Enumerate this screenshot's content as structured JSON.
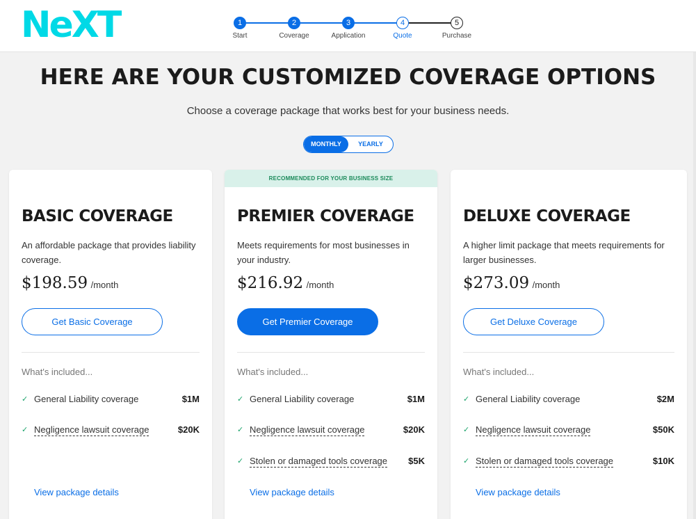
{
  "brand": {
    "logo": "NeXT",
    "logo_color": "#00d9e6",
    "accent": "#0a6ee6"
  },
  "steps": [
    {
      "num": "1",
      "label": "Start",
      "status": "done"
    },
    {
      "num": "2",
      "label": "Coverage",
      "status": "done"
    },
    {
      "num": "3",
      "label": "Application",
      "status": "done"
    },
    {
      "num": "4",
      "label": "Quote",
      "status": "current"
    },
    {
      "num": "5",
      "label": "Purchase",
      "status": "todo"
    }
  ],
  "page": {
    "title": "Here are your customized coverage options",
    "subtitle": "Choose a coverage package that works best for your business needs."
  },
  "toggle": {
    "monthly": "MONTHLY",
    "yearly": "YEARLY",
    "selected": "monthly"
  },
  "cards": [
    {
      "title": "BASIC COVERAGE",
      "description": "An affordable package that provides liability coverage.",
      "price": "$198.59",
      "per": "/month",
      "cta": "Get Basic Coverage",
      "included_label": "What's included...",
      "features": [
        {
          "label": "General Liability coverage",
          "value": "$1M"
        },
        {
          "label": "Negligence lawsuit coverage",
          "value": "$20K"
        }
      ],
      "details_link": "View package details"
    },
    {
      "banner": "RECOMMENDED FOR YOUR BUSINESS SIZE",
      "title": "PREMIER COVERAGE",
      "description": "Meets requirements for most businesses in your industry.",
      "price": "$216.92",
      "per": "/month",
      "cta": "Get Premier Coverage",
      "included_label": "What's included...",
      "features": [
        {
          "label": "General Liability coverage",
          "value": "$1M"
        },
        {
          "label": "Negligence lawsuit coverage",
          "value": "$20K"
        },
        {
          "label": "Stolen or damaged tools coverage",
          "value": "$5K"
        }
      ],
      "details_link": "View package details"
    },
    {
      "title": "DELUXE COVERAGE",
      "description": "A higher limit package that meets requirements for larger businesses.",
      "price": "$273.09",
      "per": "/month",
      "cta": "Get Deluxe Coverage",
      "included_label": "What's included...",
      "features": [
        {
          "label": "General Liability coverage",
          "value": "$2M"
        },
        {
          "label": "Negligence lawsuit coverage",
          "value": "$50K"
        },
        {
          "label": "Stolen or damaged tools coverage",
          "value": "$10K"
        }
      ],
      "details_link": "View package details"
    }
  ]
}
